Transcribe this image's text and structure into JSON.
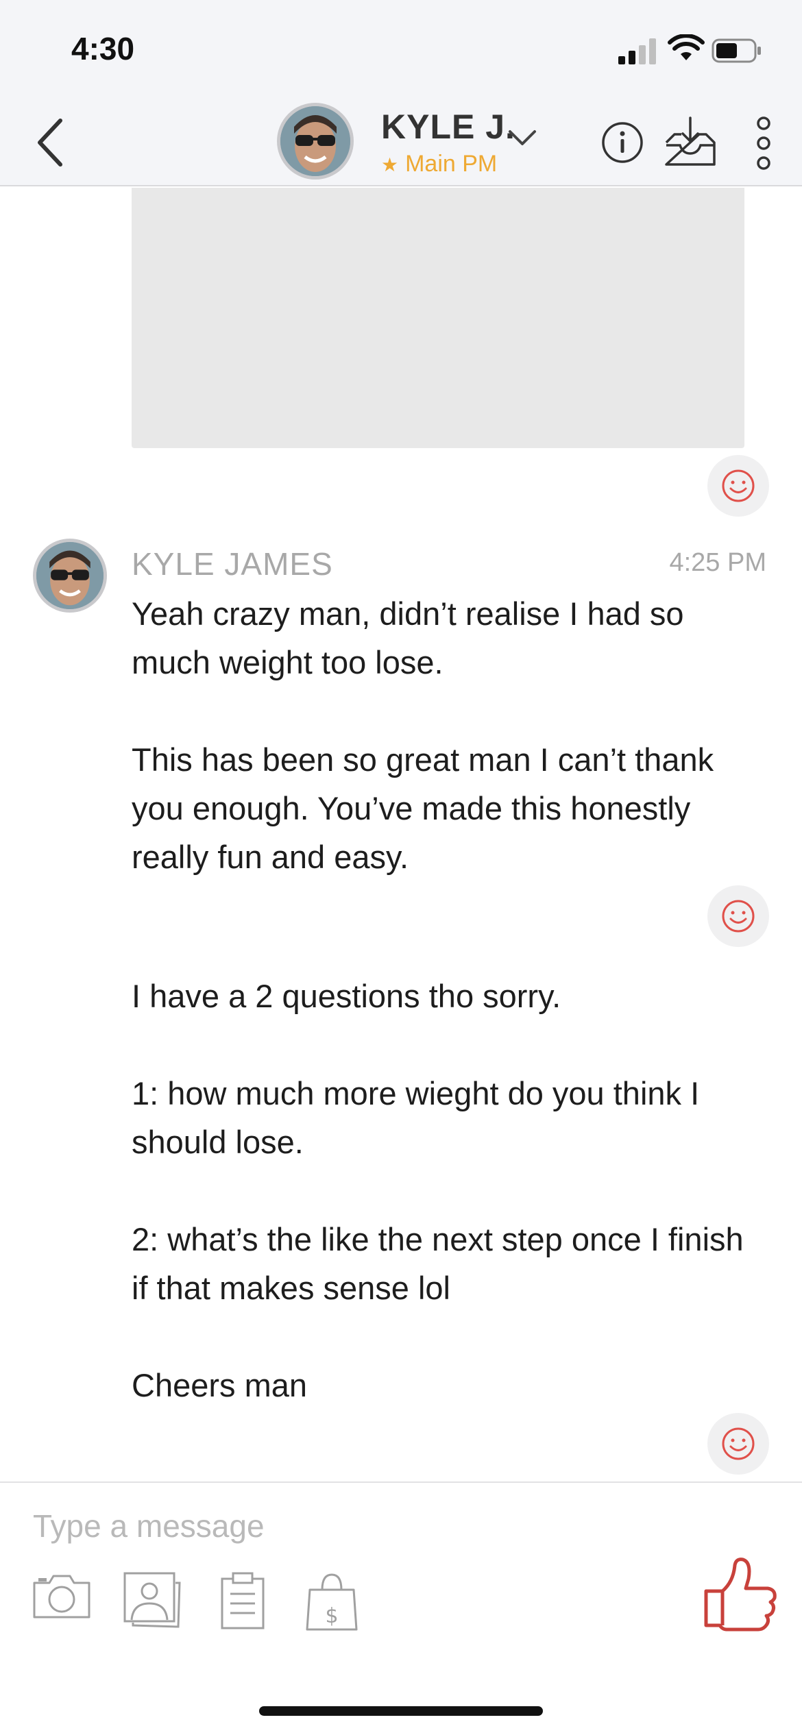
{
  "status_bar": {
    "time": "4:30",
    "icons": [
      "cellular-signal-icon",
      "wifi-icon",
      "battery-icon"
    ]
  },
  "header": {
    "back_icon": "chevron-left-icon",
    "name": "KYLE J.",
    "subtitle": "Main PM",
    "subtitle_icon": "star-icon",
    "dropdown_icon": "chevron-down-icon",
    "actions": [
      "info-icon",
      "inbox-download-icon",
      "more-vertical-icon"
    ]
  },
  "thread": {
    "message": {
      "sender": "KYLE JAMES",
      "time": "4:25 PM",
      "part1": "Yeah crazy man, didn’t realise I had so much weight too lose.\n\nThis has been so great man I can’t thank you enough. You’ve made this honestly really fun and easy.",
      "part2": "I have a 2 questions tho sorry.\n\n1: how much more wieght do you think I should lose.\n\n2: what’s the like the next step once I finish if that makes sense lol\n\nCheers man"
    },
    "reaction_icon": "smiley-icon"
  },
  "composer": {
    "placeholder": "Type a message",
    "tools": [
      "camera-icon",
      "photo-library-icon",
      "clipboard-icon",
      "shopping-bag-dollar-icon"
    ],
    "send_icon": "thumbs-up-icon"
  },
  "colors": {
    "header_bg": "#f4f5f8",
    "accent_orange": "#eea933",
    "reaction_red": "#e0504a",
    "like_red": "#c8413b",
    "muted_text": "#a8a8a8"
  }
}
